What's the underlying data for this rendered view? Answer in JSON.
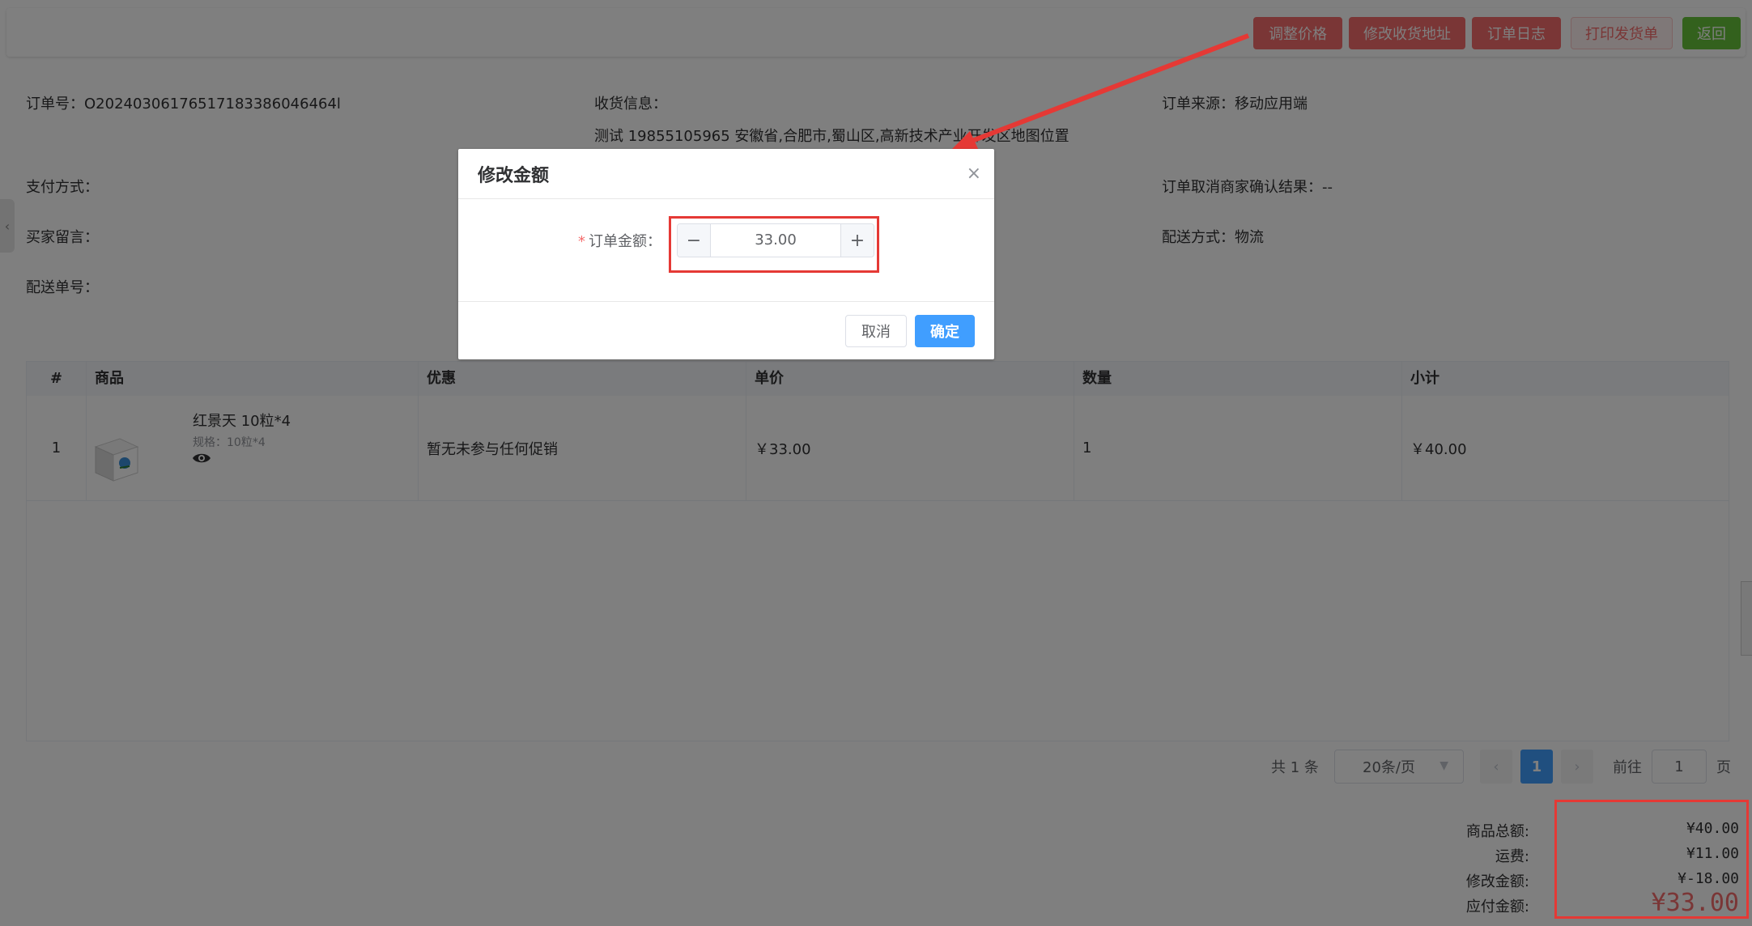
{
  "toolbar": {
    "adjust_price": "调整价格",
    "edit_address": "修改收货地址",
    "order_log": "订单日志",
    "print_invoice": "打印发货单",
    "back": "返回"
  },
  "info": {
    "order_no": "订单号：O20240306176517183386046464l",
    "receiver_label": "收货信息：",
    "receiver_detail": "测试 19855105965 安徽省,合肥市,蜀山区,高新技术产业开发区地图位置",
    "order_source": "订单来源：移动应用端",
    "payment_method": "支付方式：",
    "cancel_result": "订单取消商家确认结果：--",
    "buyer_note": "买家留言：",
    "delivery_method": "配送方式：物流",
    "delivery_no": "配送单号："
  },
  "table": {
    "headers": [
      "#",
      "商品",
      "优惠",
      "单价",
      "数量",
      "小计"
    ],
    "rows": [
      {
        "index": "1",
        "product_name": "红景天 10粒*4",
        "product_spec": "规格：10粒*4",
        "promotion": "暂无未参与任何促销",
        "unit_price": "￥33.00",
        "quantity": "1",
        "subtotal": "￥40.00"
      }
    ]
  },
  "pagination": {
    "total": "共 1 条",
    "page_size": "20条/页",
    "prev": "‹",
    "current_page": "1",
    "next": "›",
    "goto_label": "前往",
    "goto_value": "1",
    "page_suffix": "页"
  },
  "summary": {
    "goods_total_label": "商品总额:",
    "goods_total": "¥40.00",
    "shipping_label": "运费:",
    "shipping": "¥11.00",
    "modify_label": "修改金额:",
    "modify": "¥-18.00",
    "payable_label": "应付金额:",
    "payable": "¥33.00"
  },
  "dialog": {
    "title": "修改金额",
    "close": "×",
    "required_mark": "*",
    "field_label": "订单金额：",
    "minus": "−",
    "value": "33.00",
    "plus": "+",
    "cancel": "取消",
    "confirm": "确定"
  },
  "colors": {
    "primary": "#409eff",
    "danger": "#f56c6c",
    "success": "#67c23a",
    "annotation": "#e53935"
  },
  "icons": {
    "eye": "eye-icon",
    "close": "close-icon",
    "chevron_down": "chevron-down-icon",
    "collapse_left": "chevron-left-icon"
  }
}
